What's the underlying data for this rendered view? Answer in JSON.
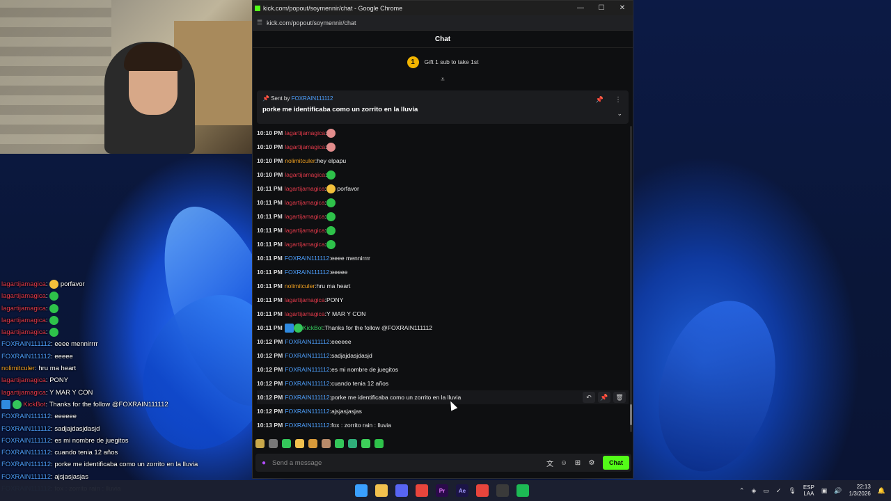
{
  "window": {
    "title": "kick.com/popout/soymennir/chat - Google Chrome",
    "url": "kick.com/popout/soymennir/chat",
    "minimize": "—",
    "maximize": "☐",
    "close": "✕"
  },
  "chat": {
    "header": "Chat",
    "gift_rank": "1",
    "gift_text": "Gift 1 sub to take 1st",
    "pinned": {
      "sent_by_label": "Sent by",
      "user": "FOXRAIN111112",
      "text": "porke me identificaba como un zorrito en la lluvia"
    },
    "messages": [
      {
        "time": "10:10 PM",
        "user": "lagartijamagica",
        "color": "#e23a4a",
        "text": "",
        "emotes": [
          "pink"
        ]
      },
      {
        "time": "10:10 PM",
        "user": "lagartijamagica",
        "color": "#e23a4a",
        "text": "",
        "emotes": [
          "pink"
        ]
      },
      {
        "time": "10:10 PM",
        "user": "nolimitculer",
        "color": "#f0a020",
        "text": "hey elpapu",
        "emotes": []
      },
      {
        "time": "10:10 PM",
        "user": "lagartijamagica",
        "color": "#e23a4a",
        "text": "",
        "emotes": [
          "green"
        ]
      },
      {
        "time": "10:11 PM",
        "user": "lagartijamagica",
        "color": "#e23a4a",
        "text": "porfavor",
        "emotes": [
          "yellow"
        ]
      },
      {
        "time": "10:11 PM",
        "user": "lagartijamagica",
        "color": "#e23a4a",
        "text": "",
        "emotes": [
          "green"
        ]
      },
      {
        "time": "10:11 PM",
        "user": "lagartijamagica",
        "color": "#e23a4a",
        "text": "",
        "emotes": [
          "green"
        ]
      },
      {
        "time": "10:11 PM",
        "user": "lagartijamagica",
        "color": "#e23a4a",
        "text": "",
        "emotes": [
          "green"
        ]
      },
      {
        "time": "10:11 PM",
        "user": "lagartijamagica",
        "color": "#e23a4a",
        "text": "",
        "emotes": [
          "green"
        ]
      },
      {
        "time": "10:11 PM",
        "user": "FOXRAIN111112",
        "color": "#4ea1ff",
        "text": "eeee mennirrrr",
        "emotes": []
      },
      {
        "time": "10:11 PM",
        "user": "FOXRAIN111112",
        "color": "#4ea1ff",
        "text": "eeeee",
        "emotes": []
      },
      {
        "time": "10:11 PM",
        "user": "nolimitculer",
        "color": "#f0a020",
        "text": "hru ma heart",
        "emotes": []
      },
      {
        "time": "10:11 PM",
        "user": "lagartijamagica",
        "color": "#e23a4a",
        "text": "PONY",
        "emotes": []
      },
      {
        "time": "10:11 PM",
        "user": "lagartijamagica",
        "color": "#e23a4a",
        "text": "Y MAR Y CON",
        "emotes": []
      },
      {
        "time": "10:11 PM",
        "user": "KickBot",
        "color": "#34c65a",
        "text": "Thanks for the follow @FOXRAIN111112",
        "emotes": [],
        "badges": true
      },
      {
        "time": "10:12 PM",
        "user": "FOXRAIN111112",
        "color": "#4ea1ff",
        "text": "eeeeee",
        "emotes": []
      },
      {
        "time": "10:12 PM",
        "user": "FOXRAIN111112",
        "color": "#4ea1ff",
        "text": "sadjajdasjdasjd",
        "emotes": []
      },
      {
        "time": "10:12 PM",
        "user": "FOXRAIN111112",
        "color": "#4ea1ff",
        "text": "es mi nombre de juegitos",
        "emotes": []
      },
      {
        "time": "10:12 PM",
        "user": "FOXRAIN111112",
        "color": "#4ea1ff",
        "text": "cuando tenia 12 años",
        "emotes": []
      },
      {
        "time": "10:12 PM",
        "user": "FOXRAIN111112",
        "color": "#4ea1ff",
        "text": "porke me identificaba como un zorrito en la lluvia",
        "emotes": [],
        "hover": true
      },
      {
        "time": "10:12 PM",
        "user": "FOXRAIN111112",
        "color": "#4ea1ff",
        "text": "ajsjasjasjas",
        "emotes": []
      },
      {
        "time": "10:13 PM",
        "user": "FOXRAIN111112",
        "color": "#4ea1ff",
        "text": "fox : zorrito rain : lluvia",
        "emotes": []
      }
    ],
    "hover_actions": [
      "reply-icon",
      "pin-icon",
      "trash-icon"
    ],
    "input_placeholder": "Send a message",
    "send_label": "Chat"
  },
  "overlay": {
    "lines": [
      {
        "user": "lagartijamagica",
        "color": "#e23a4a",
        "text": "porfavor",
        "emotes": [
          "yellow"
        ]
      },
      {
        "user": "lagartijamagica",
        "color": "#e23a4a",
        "text": "",
        "emotes": [
          "green"
        ]
      },
      {
        "user": "lagartijamagica",
        "color": "#e23a4a",
        "text": "",
        "emotes": [
          "green"
        ]
      },
      {
        "user": "lagartijamagica",
        "color": "#e23a4a",
        "text": "",
        "emotes": [
          "green"
        ]
      },
      {
        "user": "lagartijamagica",
        "color": "#e23a4a",
        "text": "",
        "emotes": [
          "green"
        ]
      },
      {
        "user": "FOXRAIN111112",
        "color": "#4ea1ff",
        "text": "eeee mennirrrr",
        "emotes": []
      },
      {
        "user": "FOXRAIN111112",
        "color": "#4ea1ff",
        "text": "eeeee",
        "emotes": []
      },
      {
        "user": "nolimitculer",
        "color": "#f0a020",
        "text": "hru ma heart",
        "emotes": []
      },
      {
        "user": "lagartijamagica",
        "color": "#e23a4a",
        "text": "PONY",
        "emotes": []
      },
      {
        "user": "lagartijamagica",
        "color": "#e23a4a",
        "text": "Y MAR Y CON",
        "emotes": []
      },
      {
        "user": "KickBot",
        "color": "#e23a4a",
        "text": "Thanks for the follow @FOXRAIN111112",
        "emotes": [],
        "badges": true
      },
      {
        "user": "FOXRAIN111112",
        "color": "#4ea1ff",
        "text": "eeeeee",
        "emotes": []
      },
      {
        "user": "FOXRAIN111112",
        "color": "#4ea1ff",
        "text": "sadjajdasjdasjd",
        "emotes": []
      },
      {
        "user": "FOXRAIN111112",
        "color": "#4ea1ff",
        "text": "es mi nombre de juegitos",
        "emotes": []
      },
      {
        "user": "FOXRAIN111112",
        "color": "#4ea1ff",
        "text": "cuando tenia 12 años",
        "emotes": []
      },
      {
        "user": "FOXRAIN111112",
        "color": "#4ea1ff",
        "text": "porke me identificaba como un zorrito en la lluvia",
        "emotes": []
      },
      {
        "user": "FOXRAIN111112",
        "color": "#4ea1ff",
        "text": "ajsjasjasjas",
        "emotes": []
      },
      {
        "user": "FOXRAIN111112",
        "color": "#4ea1ff",
        "text": "fox : zorrito rain : lluvia",
        "emotes": []
      }
    ]
  },
  "taskbar": {
    "apps": [
      {
        "name": "windows-start",
        "label": "",
        "color": "#3aa0ff"
      },
      {
        "name": "file-explorer",
        "label": "",
        "color": "#f2c14e"
      },
      {
        "name": "discord",
        "label": "",
        "color": "#5865f2"
      },
      {
        "name": "chrome",
        "label": "",
        "color": "#e8453c"
      },
      {
        "name": "premiere-pro",
        "label": "Pr",
        "color": "#2a0a4a"
      },
      {
        "name": "after-effects",
        "label": "Ae",
        "color": "#1b1446"
      },
      {
        "name": "chrome-active",
        "label": "",
        "color": "#e8453c"
      },
      {
        "name": "obs",
        "label": "",
        "color": "#3a3a3a"
      },
      {
        "name": "spotify",
        "label": "",
        "color": "#1db954"
      }
    ],
    "lang_top": "ESP",
    "lang_bottom": "LAA",
    "time": "22:13",
    "date": "1/3/2026"
  }
}
